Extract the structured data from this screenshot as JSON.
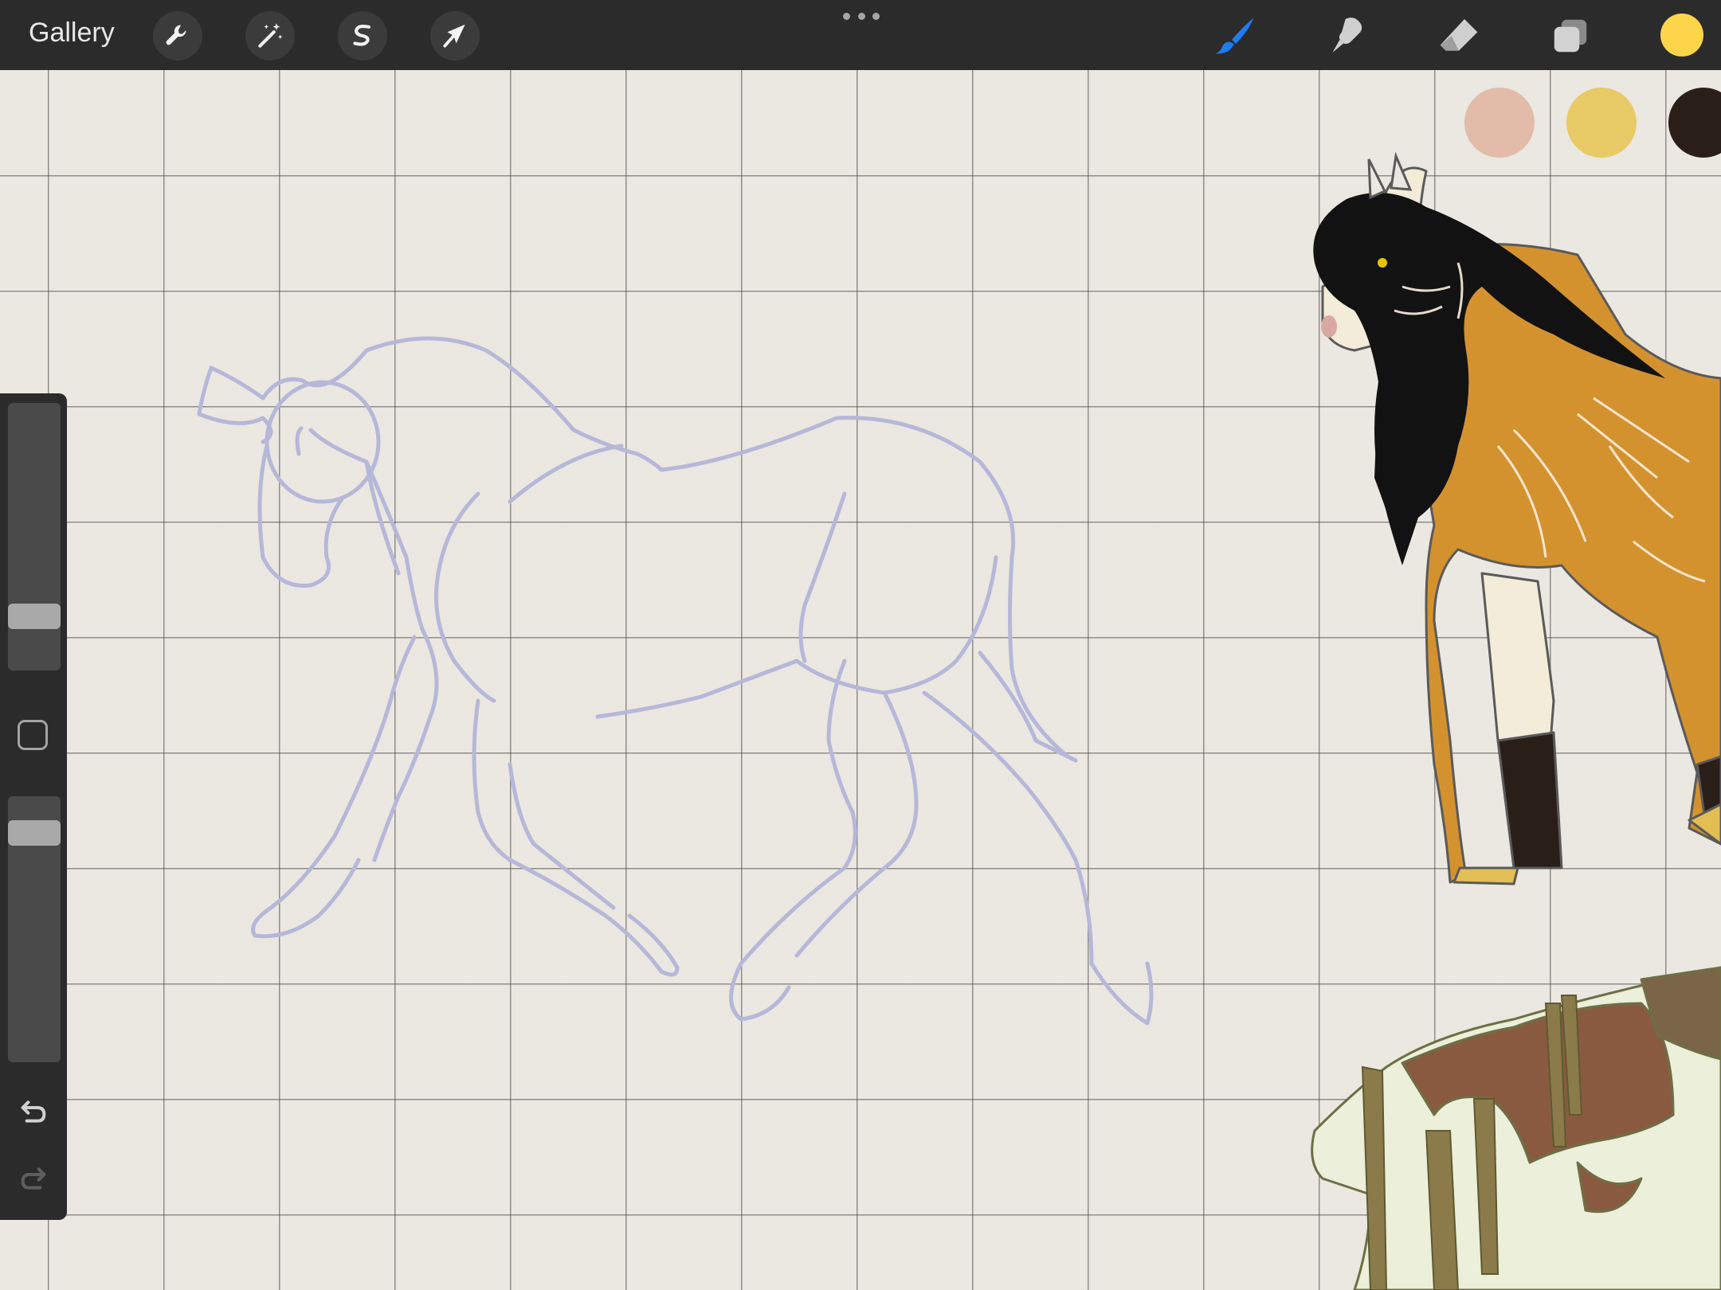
{
  "toolbar": {
    "gallery_label": "Gallery",
    "left_tools": [
      "wrench-icon",
      "magic-wand-icon",
      "selection-s-icon",
      "transform-arrow-icon"
    ],
    "right_tools": [
      "brush-icon",
      "smudge-icon",
      "eraser-icon",
      "layers-icon"
    ],
    "active_tool": "brush",
    "brush_color": "#1d7cf2",
    "current_color": "#fdd54a"
  },
  "swatches": [
    "#e2bba9",
    "#e8ca66",
    "#2a1e19"
  ],
  "sidebar": {
    "brush_size_level": 0.17,
    "opacity_level": 0.9,
    "undo_icon": "undo-icon",
    "redo_icon": "redo-icon"
  },
  "canvas": {
    "background": "#ebe7e1",
    "sketch_color": "#b5b8d8"
  }
}
